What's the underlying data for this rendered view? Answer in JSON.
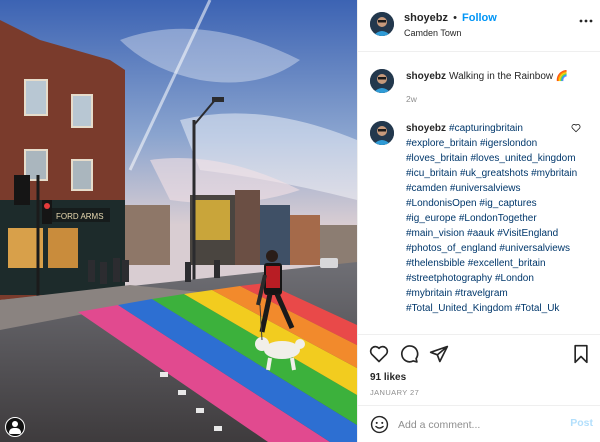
{
  "post": {
    "username": "shoyebz",
    "separator": "•",
    "follow_label": "Follow",
    "location": "Camden Town",
    "more_icon": "more-horizontal-icon"
  },
  "caption": {
    "username": "shoyebz",
    "text": "Walking in the Rainbow 🌈",
    "time": "2w"
  },
  "comment": {
    "username": "shoyebz",
    "tags": [
      "#capturingbritain",
      "#explore_britain",
      "#igerslondon",
      "#loves_britain",
      "#loves_united_kingdom",
      "#icu_britain",
      "#uk_greatshots",
      "#mybritain",
      "#camden",
      "#universalviews",
      "#LondonisOpen",
      "#ig_captures",
      "#ig_europe",
      "#LondonTogether",
      "#main_vision",
      "#aauk",
      "#VisitEngland",
      "#photos_of_england",
      "#universalviews",
      "#thelensbible",
      "#excellent_britain",
      "#streetphotography",
      "#London",
      "#mybritain",
      "#travelgram",
      "#Total_United_Kingdom",
      "#Total_Uk"
    ]
  },
  "actions": {
    "like_icon": "heart-icon",
    "comment_icon": "comment-icon",
    "share_icon": "share-icon",
    "save_icon": "bookmark-icon"
  },
  "likes": "91 likes",
  "date": "JANUARY 27",
  "add_comment": {
    "placeholder": "Add a comment...",
    "post_label": "Post",
    "emoji_icon": "emoji-icon"
  },
  "colors": {
    "follow": "#0095f6",
    "hashtag": "#00376b",
    "post_disabled": "#b2dffc",
    "rainbow": [
      "#e14a8f",
      "#2d6fd2",
      "#3cb13c",
      "#f2cc1f",
      "#f28a2c",
      "#e94949"
    ]
  }
}
